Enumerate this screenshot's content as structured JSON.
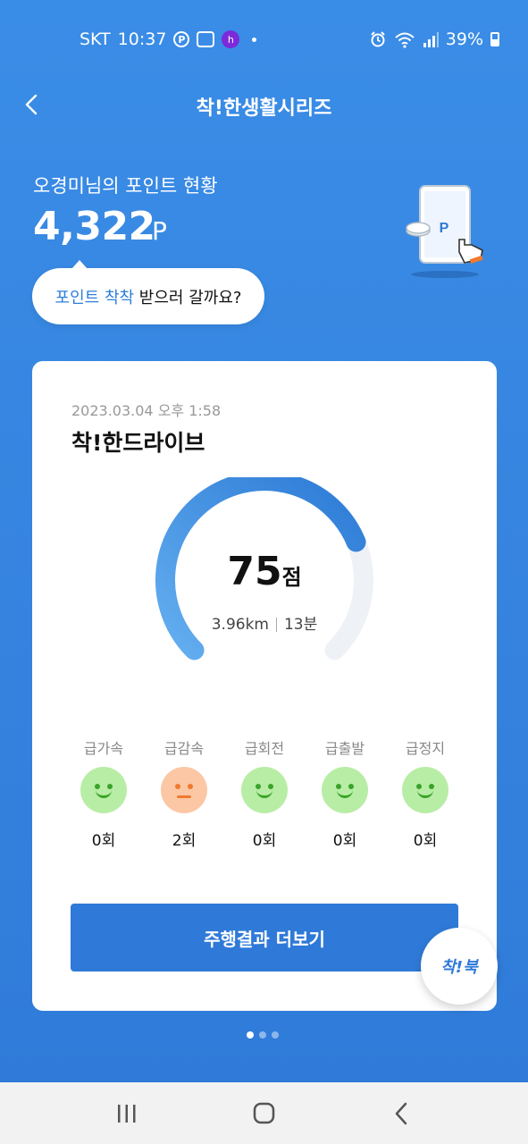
{
  "status_bar": {
    "carrier": "SKT",
    "time": "10:37",
    "battery": "39%"
  },
  "header": {
    "title": "착!한생활시리즈"
  },
  "points": {
    "label": "오경미님의 포인트 현황",
    "value": "4,322",
    "unit": "P"
  },
  "bubble": {
    "highlight": "포인트 착착",
    "rest": " 받으러 갈까요?"
  },
  "card": {
    "date": "2023.03.04 오후 1:58",
    "title": "착!한드라이브",
    "score": "75",
    "score_unit": "점",
    "score_fraction": 0.75,
    "distance": "3.96km",
    "duration": "13분",
    "metrics": [
      {
        "label": "급가속",
        "count": "0회",
        "face": "happy"
      },
      {
        "label": "급감속",
        "count": "2회",
        "face": "neutral"
      },
      {
        "label": "급회전",
        "count": "0회",
        "face": "happy"
      },
      {
        "label": "급출발",
        "count": "0회",
        "face": "happy"
      },
      {
        "label": "급정지",
        "count": "0회",
        "face": "happy"
      }
    ],
    "button": "주행결과 더보기"
  },
  "fab": {
    "label": "착!북"
  },
  "pager": {
    "count": 3,
    "active": 0
  },
  "colors": {
    "accent": "#2f7ad8",
    "background": "#3a8de6",
    "good_face": "#b8eda5",
    "warn_face": "#fbc7a5"
  }
}
